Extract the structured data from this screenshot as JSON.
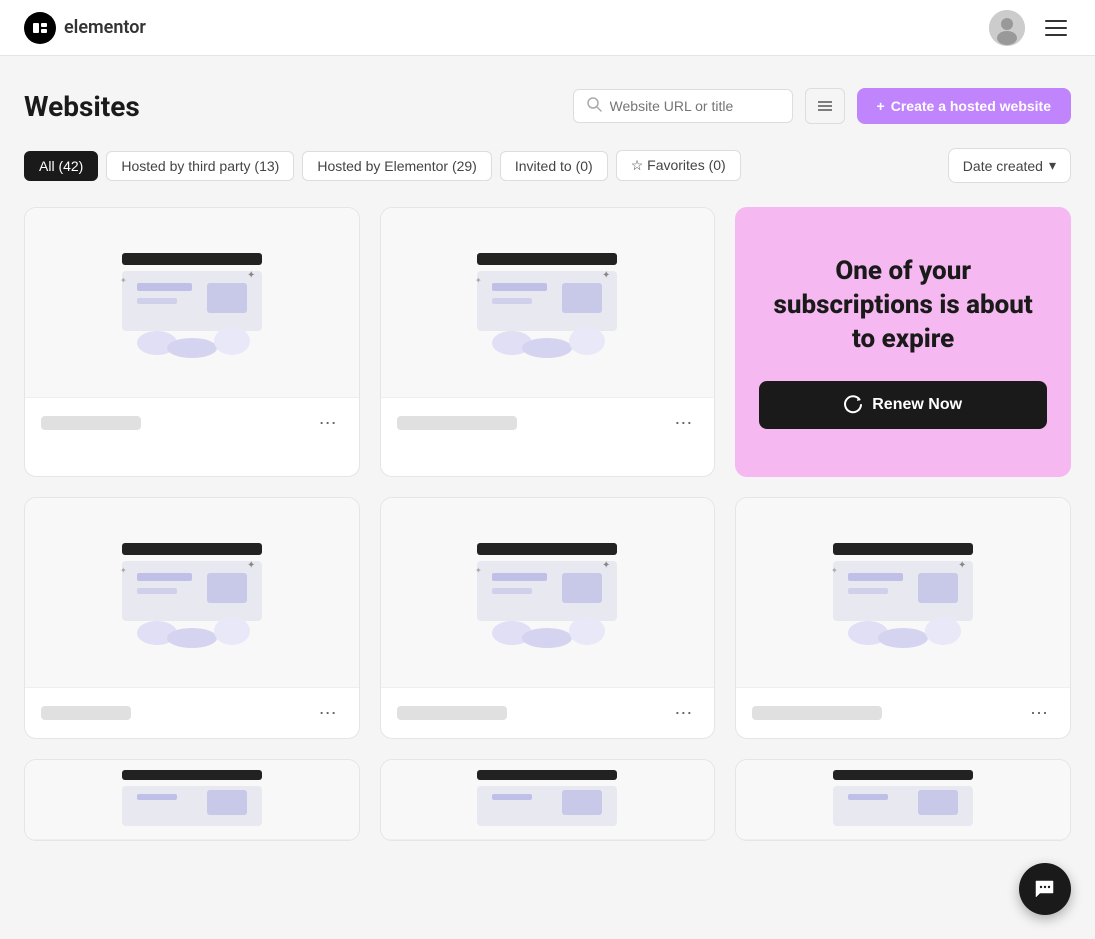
{
  "header": {
    "logo_letter": "e",
    "logo_name": "elementor",
    "menu_label": "Menu",
    "avatar_alt": "User avatar"
  },
  "page": {
    "title": "Websites",
    "search_placeholder": "Website URL or title"
  },
  "filter_tabs": [
    {
      "id": "all",
      "label": "All (42)",
      "active": true
    },
    {
      "id": "hosted-third-party",
      "label": "Hosted by third party (13)",
      "active": false
    },
    {
      "id": "hosted-elementor",
      "label": "Hosted by Elementor (29)",
      "active": false
    },
    {
      "id": "invited",
      "label": "Invited to (0)",
      "active": false
    },
    {
      "id": "favorites",
      "label": "Favorites (0)",
      "active": false,
      "has_star": true
    }
  ],
  "sort": {
    "label": "Date created",
    "chevron": "▾"
  },
  "create_button": {
    "label": "Create a hosted website",
    "icon": "+"
  },
  "promo": {
    "title": "One of your subscriptions is about to expire",
    "renew_label": "Renew Now"
  },
  "cards": [
    {
      "id": 1,
      "title_width": 100
    },
    {
      "id": 2,
      "title_width": 120
    },
    {
      "id": 3,
      "promo": true
    },
    {
      "id": 4,
      "title_width": 90
    },
    {
      "id": 5,
      "title_width": 110
    },
    {
      "id": 6,
      "title_width": 130
    },
    {
      "id": 7,
      "title_width": 80,
      "partial": true
    },
    {
      "id": 8,
      "title_width": 100,
      "partial": true
    },
    {
      "id": 9,
      "title_width": 115,
      "partial": true
    }
  ],
  "chat_icon": "💬"
}
